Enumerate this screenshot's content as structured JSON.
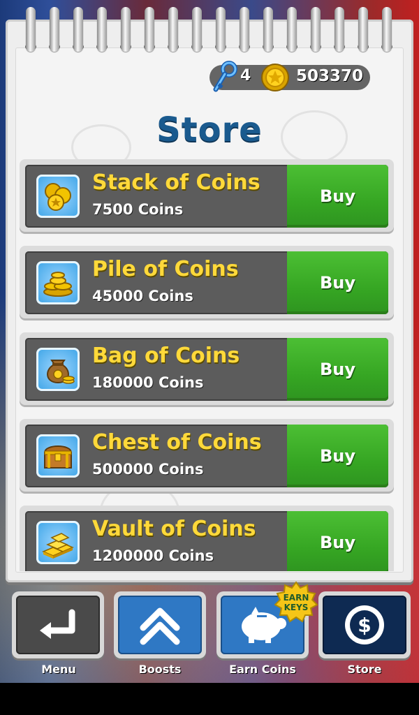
{
  "currency": {
    "keys": "4",
    "coins": "503370"
  },
  "store": {
    "title": "Store",
    "buy_label": "Buy",
    "items": [
      {
        "name": "Stack of Coins",
        "price": "7500 Coins",
        "icon": "coin-stack-icon"
      },
      {
        "name": "Pile of Coins",
        "price": "45000 Coins",
        "icon": "coin-pile-icon"
      },
      {
        "name": "Bag of Coins",
        "price": "180000 Coins",
        "icon": "coin-bag-icon"
      },
      {
        "name": "Chest of Coins",
        "price": "500000 Coins",
        "icon": "treasure-chest-icon"
      },
      {
        "name": "Vault of Coins",
        "price": "1200000 Coins",
        "icon": "gold-bars-icon"
      }
    ]
  },
  "nav": {
    "menu": "Menu",
    "boosts": "Boosts",
    "earn_coins": "Earn Coins",
    "earn_badge": "EARN KEYS",
    "store": "Store"
  },
  "colors": {
    "title": "#1a5a8e",
    "buy": "#36a623",
    "item_name": "#ffd93a",
    "nav_blue": "#2f78c4",
    "nav_store": "#0e2a52"
  }
}
